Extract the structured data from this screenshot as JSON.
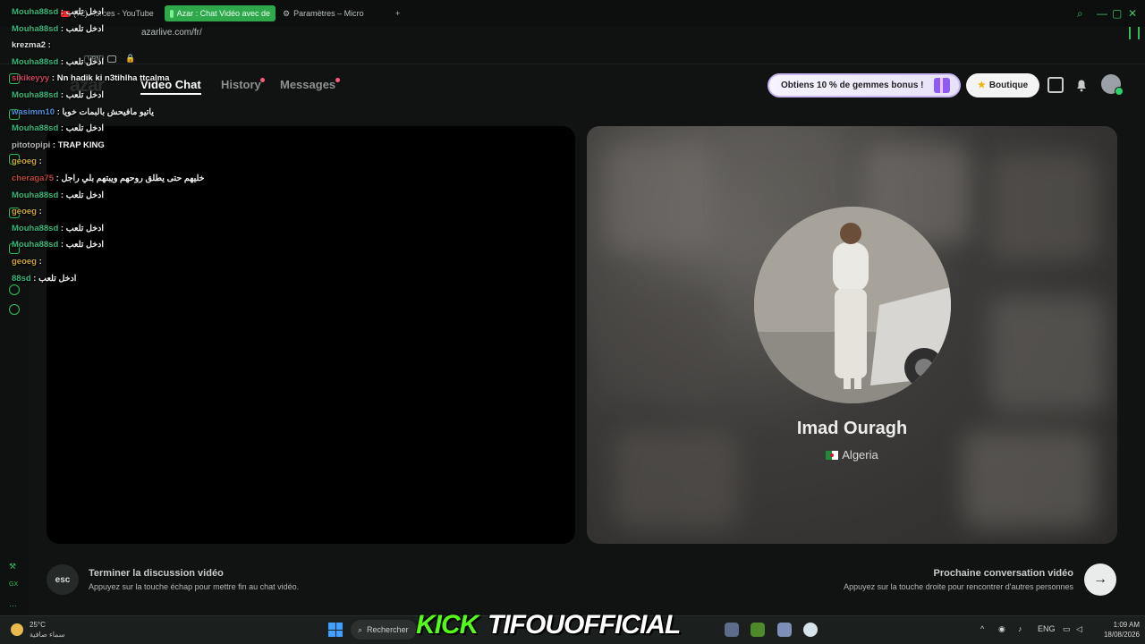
{
  "browser": {
    "tabs": [
      {
        "label": "(72) Xerces - YouTube",
        "active": false
      },
      {
        "label": "Azar : Chat Vidéo avec de",
        "active": true
      },
      {
        "label": "Paramètres – Micro",
        "active": false
      }
    ],
    "new_tab": "+",
    "url": "azarlive.com/fr/",
    "vpn_label": "VPN"
  },
  "azar": {
    "logo": "azar",
    "nav": [
      {
        "label": "Video Chat",
        "active": true,
        "dot": false
      },
      {
        "label": "History",
        "active": false,
        "dot": true
      },
      {
        "label": "Messages",
        "active": false,
        "dot": true
      }
    ],
    "promo_label": "Obtiens 10 % de gemmes bonus !",
    "shop_label": "Boutique",
    "shop_icon": "★"
  },
  "partner": {
    "name": "Imad Ouragh",
    "country": "Algeria"
  },
  "controls": {
    "esc_key": "esc",
    "end_title": "Terminer la discussion vidéo",
    "end_sub": "Appuyez sur la touche échap pour mettre fin au chat vidéo.",
    "next_title": "Prochaine conversation vidéo",
    "next_sub": "Appuyez sur la touche droite pour rencontrer d'autres personnes",
    "next_arrow": "→"
  },
  "chat": [
    {
      "user": "Mouha88sd",
      "sep": " : ",
      "msg": "ادخل تلعب",
      "color": "#35b87a"
    },
    {
      "user": "Mouha88sd",
      "sep": " : ",
      "msg": "ادخل تلعب",
      "color": "#35b87a"
    },
    {
      "user": "krezma2",
      "sep": " : ",
      "msg": "",
      "color": "#e0e0e0"
    },
    {
      "user": "Mouha88sd",
      "sep": " : ",
      "msg": "ادخل تلعب",
      "color": "#35b87a"
    },
    {
      "user": "sikikeyyy",
      "sep": " : ",
      "msg": "Nn hadik ki n3tihlha ttcalma",
      "color": "#c9445e"
    },
    {
      "user": "Mouha88sd",
      "sep": " : ",
      "msg": "ادخل تلعب",
      "color": "#35b87a"
    },
    {
      "user": "wasimm10",
      "sep": " : ",
      "msg": "ياتيو مافيحش بالبمات خويا",
      "color": "#4f8fd8"
    },
    {
      "user": "Mouha88sd",
      "sep": " : ",
      "msg": "ادخل تلعب",
      "color": "#35b87a"
    },
    {
      "user": "pitotopipi",
      "sep": " : ",
      "msg": "TRAP KING",
      "color": "#b5b5b5"
    },
    {
      "user": "geoeg",
      "sep": " : ",
      "msg": "",
      "color": "#c9a53a"
    },
    {
      "user": "cheraga75",
      "sep": " : ",
      "msg": "خليهم حتى يطلق روحهم ويبتهم بلي راجل",
      "color": "#b9463a"
    },
    {
      "user": "Mouha88sd",
      "sep": " : ",
      "msg": "ادخل تلعب",
      "color": "#35b87a"
    },
    {
      "user": "geoeg",
      "sep": " : ",
      "msg": "",
      "color": "#c9a53a"
    },
    {
      "user": "Mouha88sd",
      "sep": " : ",
      "msg": "ادخل تلعب",
      "color": "#35b87a"
    },
    {
      "user": "Mouha88sd",
      "sep": " : ",
      "msg": "ادخل تلعب",
      "color": "#35b87a"
    },
    {
      "user": "geoeg",
      "sep": " : ",
      "msg": "",
      "color": "#c9a53a"
    },
    {
      "user": "88sd",
      "sep": " : ",
      "msg": "ادخل تلعب",
      "color": "#35b87a"
    }
  ],
  "taskbar": {
    "temperature": "25°C",
    "weather": "سماء صافية",
    "search_label": "Rechercher",
    "kick_label": "KICK",
    "channel_label": "TIFOUOFFICIAL",
    "lang": "ENG",
    "time": "1:09 AM",
    "date": "18/08/2026"
  }
}
